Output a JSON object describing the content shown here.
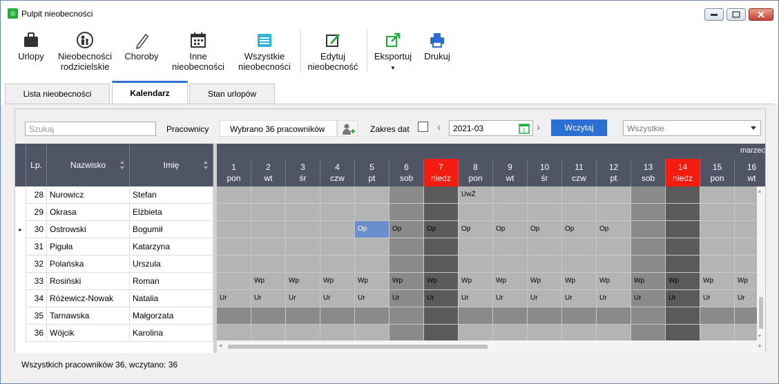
{
  "window": {
    "title": "Pulpit nieobecności"
  },
  "ribbon": {
    "urlopy": "Urlopy",
    "rodzicielskie_1": "Nieobecności",
    "rodzicielskie_2": "rodzicielskie",
    "choroby": "Choroby",
    "inne_1": "Inne",
    "inne_2": "nieobecności",
    "wszystkie_1": "Wszystkie",
    "wszystkie_2": "nieobecności",
    "edytuj_1": "Edytuj",
    "edytuj_2": "nieobecność",
    "eksportuj": "Eksportuj",
    "drukuj": "Drukuj"
  },
  "tabs": {
    "lista": "Lista nieobecności",
    "kalendarz": "Kalendarz",
    "stan": "Stan urlopów"
  },
  "filters": {
    "search_placeholder": "Szukaj",
    "employees_label": "Pracownicy",
    "employees_value": "Wybrano 36 pracowników",
    "date_range_label": "Zakres dat",
    "month_value": "2021-03",
    "load_label": "Wczytaj",
    "type_value": "Wszystkie"
  },
  "table": {
    "headers": {
      "lp": "Lp.",
      "nazwisko": "Nazwisko",
      "imie": "Imię"
    },
    "rows": [
      {
        "lp": "28",
        "nazwisko": "Nurowicz",
        "imie": "Stefan"
      },
      {
        "lp": "29",
        "nazwisko": "Okrasa",
        "imie": "Elżbieta"
      },
      {
        "lp": "30",
        "nazwisko": "Ostrowski",
        "imie": "Bogumił"
      },
      {
        "lp": "31",
        "nazwisko": "Piguła",
        "imie": "Katarzyna"
      },
      {
        "lp": "32",
        "nazwisko": "Polańska",
        "imie": "Urszula"
      },
      {
        "lp": "33",
        "nazwisko": "Rosiński",
        "imie": "Roman"
      },
      {
        "lp": "34",
        "nazwisko": "Różewicz-Nowak",
        "imie": "Natalia"
      },
      {
        "lp": "35",
        "nazwisko": "Tarnawska",
        "imie": "Małgorzata"
      },
      {
        "lp": "36",
        "nazwisko": "Wójcik",
        "imie": "Karolina"
      }
    ],
    "selected_row": 2
  },
  "calendar": {
    "month_label": "marzec",
    "days": [
      {
        "num": "1",
        "dow": "pon",
        "type": "work"
      },
      {
        "num": "2",
        "dow": "wt",
        "type": "work"
      },
      {
        "num": "3",
        "dow": "śr",
        "type": "work"
      },
      {
        "num": "4",
        "dow": "czw",
        "type": "work"
      },
      {
        "num": "5",
        "dow": "pt",
        "type": "work"
      },
      {
        "num": "6",
        "dow": "sob",
        "type": "sat"
      },
      {
        "num": "7",
        "dow": "niedz",
        "type": "sun"
      },
      {
        "num": "8",
        "dow": "pon",
        "type": "work"
      },
      {
        "num": "9",
        "dow": "wt",
        "type": "work"
      },
      {
        "num": "10",
        "dow": "śr",
        "type": "work"
      },
      {
        "num": "11",
        "dow": "czw",
        "type": "work"
      },
      {
        "num": "12",
        "dow": "pt",
        "type": "work"
      },
      {
        "num": "13",
        "dow": "sob",
        "type": "sat"
      },
      {
        "num": "14",
        "dow": "niedz",
        "type": "sun"
      },
      {
        "num": "15",
        "dow": "pon",
        "type": "work"
      },
      {
        "num": "16",
        "dow": "wt",
        "type": "work"
      }
    ],
    "cells": [
      [
        "",
        "",
        "",
        "",
        "",
        "",
        "",
        "UwŻ",
        "",
        "",
        "",
        "",
        "",
        "",
        "",
        ""
      ],
      [
        "",
        "",
        "",
        "",
        "",
        "",
        "",
        "",
        "",
        "",
        "",
        "",
        "",
        "",
        "",
        ""
      ],
      [
        "",
        "",
        "",
        "",
        "Op",
        "Op",
        "Op",
        "Op",
        "Op",
        "Op",
        "Op",
        "Op",
        "",
        "",
        "",
        ""
      ],
      [
        "",
        "",
        "",
        "",
        "",
        "",
        "",
        "",
        "",
        "",
        "",
        "",
        "",
        "",
        "",
        ""
      ],
      [
        "",
        "",
        "",
        "",
        "",
        "",
        "",
        "",
        "",
        "",
        "",
        "",
        "",
        "",
        "",
        ""
      ],
      [
        "",
        "Wp",
        "Wp",
        "Wp",
        "Wp",
        "Wp",
        "Wp",
        "Wp",
        "Wp",
        "Wp",
        "Wp",
        "Wp",
        "Wp",
        "Wp",
        "Wp",
        "Wp"
      ],
      [
        "Ur",
        "Ur",
        "Ur",
        "Ur",
        "Ur",
        "Ur",
        "Ur",
        "Ur",
        "Ur",
        "Ur",
        "Ur",
        "Ur",
        "Ur",
        "Ur",
        "Ur",
        "Ur"
      ],
      [
        "",
        "",
        "",
        "",
        "",
        "",
        "",
        "",
        "",
        "",
        "",
        "",
        "",
        "",
        "",
        ""
      ],
      [
        "",
        "",
        "",
        "",
        "",
        "",
        "",
        "",
        "",
        "",
        "",
        "",
        "",
        "",
        "",
        ""
      ]
    ],
    "dark_rows": [
      7
    ],
    "highlight_cell": {
      "row": 2,
      "col": 4
    },
    "colors": {
      "work": "#b4b4b4",
      "sat": "#8a8a8a",
      "sun": "#5a5a5a",
      "dark_work": "#8a8a8a",
      "highlight": "#6b8fcc",
      "header": "#505566",
      "holiday_header": "#f41b0f"
    }
  },
  "status": {
    "text": "Wszystkich pracowników 36, wczytano: 36"
  }
}
